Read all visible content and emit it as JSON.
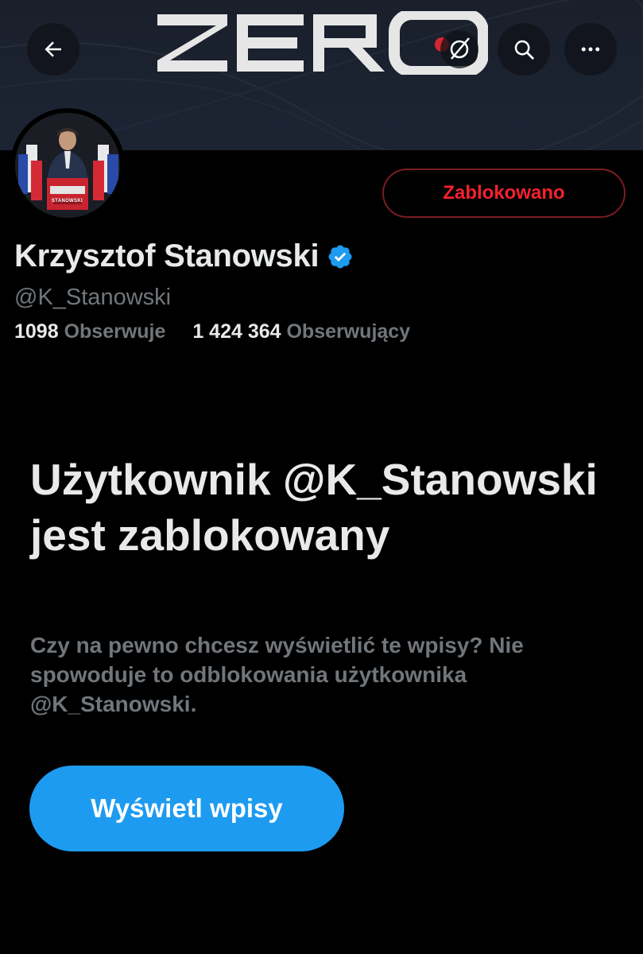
{
  "banner": {
    "logo_text": "ZERO"
  },
  "header": {
    "back_icon": "arrow-left-icon",
    "search_icon": "search-icon",
    "more_icon": "more-horizontal-icon"
  },
  "profile": {
    "display_name": "Krzysztof Stanowski",
    "handle": "@K_Stanowski",
    "verified": true,
    "verified_color": "#1d9bf0",
    "following_count": "1098",
    "following_label": "Obserwuje",
    "followers_count": "1 424 364",
    "followers_label": "Obserwujący",
    "avatar_banner_text": "STANOWSKI"
  },
  "actions": {
    "blocked_label": "Zablokowano",
    "blocked_color": "#f4212e"
  },
  "blocked_notice": {
    "title": "Użytkownik @K_Stanowski jest zablokowany",
    "description": "Czy na pewno chcesz wyświetlić te wpisy? Nie spowoduje to odblokowania użytkownika @K_Stanowski.",
    "view_button_label": "Wyświetl wpisy",
    "accent_color": "#1d9bf0"
  }
}
